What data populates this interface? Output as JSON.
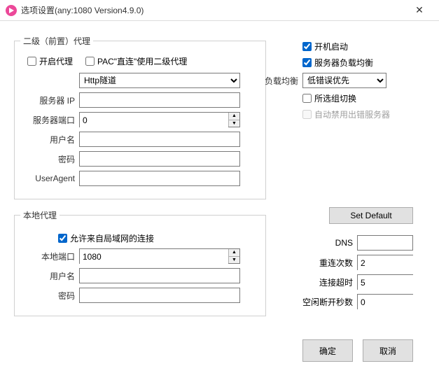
{
  "window": {
    "title": "选项设置(any:1080 Version4.9.0)"
  },
  "proxy2": {
    "legend": "二级（前置）代理",
    "enable_label": "开启代理",
    "enable_checked": false,
    "pac_label": "PAC\"直连\"使用二级代理",
    "pac_checked": false,
    "type_value": "Http隧道",
    "ip_label": "服务器 IP",
    "ip_value": "",
    "port_label": "服务器端口",
    "port_value": "0",
    "user_label": "用户名",
    "user_value": "",
    "pass_label": "密码",
    "pass_value": "",
    "ua_label": "UserAgent",
    "ua_value": ""
  },
  "local": {
    "legend": "本地代理",
    "lan_label": "允许来自局域网的连接",
    "lan_checked": true,
    "port_label": "本地端口",
    "port_value": "1080",
    "user_label": "用户名",
    "user_value": "",
    "pass_label": "密码",
    "pass_value": ""
  },
  "right": {
    "autostart_label": "开机启动",
    "autostart_checked": true,
    "loadbalance_label": "服务器负载均衡",
    "loadbalance_checked": true,
    "lb_label": "负载均衡",
    "lb_value": "低错误优先",
    "groupswitch_label": "所选组切换",
    "groupswitch_checked": false,
    "disableerr_label": "自动禁用出错服务器",
    "disableerr_checked": false,
    "setdefault_label": "Set Default",
    "dns_label": "DNS",
    "dns_value": "",
    "retry_label": "重连次数",
    "retry_value": "2",
    "timeout_label": "连接超时",
    "timeout_value": "5",
    "idle_label": "空闲断开秒数",
    "idle_value": "0"
  },
  "buttons": {
    "ok": "确定",
    "cancel": "取消"
  }
}
